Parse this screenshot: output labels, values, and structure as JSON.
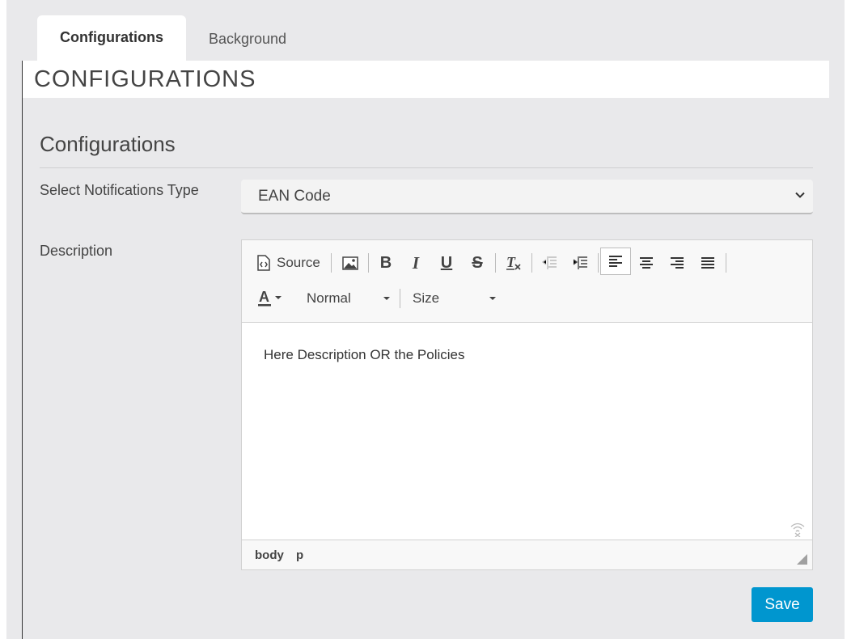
{
  "tabs": [
    {
      "label": "Configurations",
      "active": true
    },
    {
      "label": "Background",
      "active": false
    }
  ],
  "header": {
    "title": "CONFIGURATIONS"
  },
  "section": {
    "title": "Configurations"
  },
  "form": {
    "notification_label": "Select Notifications Type",
    "notification_value": "EAN Code",
    "description_label": "Description"
  },
  "editor": {
    "source_label": "Source",
    "format_combo": "Normal",
    "size_combo": "Size",
    "content": "Here Description OR the Policies",
    "path": [
      "body",
      "p"
    ],
    "icons": [
      "source-icon",
      "image-icon",
      "bold-icon",
      "italic-icon",
      "underline-icon",
      "strikethrough-icon",
      "remove-format-icon",
      "outdent-icon",
      "indent-icon",
      "align-left-icon",
      "align-center-icon",
      "align-right-icon",
      "justify-icon",
      "text-color-icon"
    ]
  },
  "actions": {
    "save_label": "Save"
  },
  "colors": {
    "accent": "#0096cf",
    "background": "#e9e9eb"
  }
}
